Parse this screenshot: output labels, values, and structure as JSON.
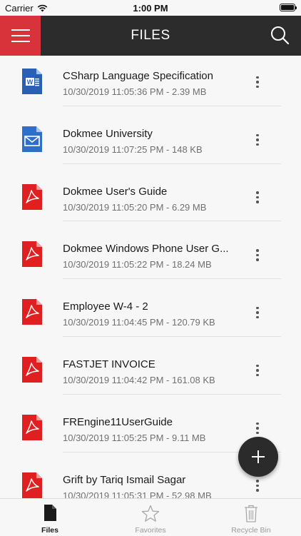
{
  "status_bar": {
    "carrier": "Carrier",
    "time": "1:00 PM"
  },
  "header": {
    "title": "FILES"
  },
  "files": [
    {
      "name": "CSharp Language Specification",
      "meta": "10/30/2019 11:05:36 PM - 2.39 MB",
      "icon": "word-doc-icon"
    },
    {
      "name": "Dokmee University",
      "meta": "10/30/2019 11:07:25 PM - 148 KB",
      "icon": "email-icon"
    },
    {
      "name": "Dokmee User's Guide",
      "meta": "10/30/2019 11:05:20 PM - 6.29 MB",
      "icon": "pdf-icon"
    },
    {
      "name": "Dokmee Windows Phone User G...",
      "meta": "10/30/2019 11:05:22 PM - 18.24 MB",
      "icon": "pdf-icon"
    },
    {
      "name": "Employee W-4 - 2",
      "meta": "10/30/2019 11:04:45 PM - 120.79 KB",
      "icon": "pdf-icon"
    },
    {
      "name": "FASTJET INVOICE",
      "meta": "10/30/2019 11:04:42 PM - 161.08 KB",
      "icon": "pdf-icon"
    },
    {
      "name": "FREngine11UserGuide",
      "meta": "10/30/2019 11:05:25 PM - 9.11 MB",
      "icon": "pdf-icon"
    },
    {
      "name": "Grift by Tariq Ismail Sagar",
      "meta": "10/30/2019 11:05:31 PM - 52.98 MB",
      "icon": "pdf-icon"
    }
  ],
  "tabs": [
    {
      "label": "Files",
      "icon": "file-icon",
      "active": true
    },
    {
      "label": "Favorites",
      "icon": "star-icon",
      "active": false
    },
    {
      "label": "Recycle Bin",
      "icon": "trash-icon",
      "active": false
    }
  ],
  "colors": {
    "header_bg": "#2c2c2c",
    "accent_red": "#d8323a",
    "word_blue": "#2b5fb4",
    "email_blue": "#2f6fc7",
    "pdf_red": "#e02020"
  }
}
